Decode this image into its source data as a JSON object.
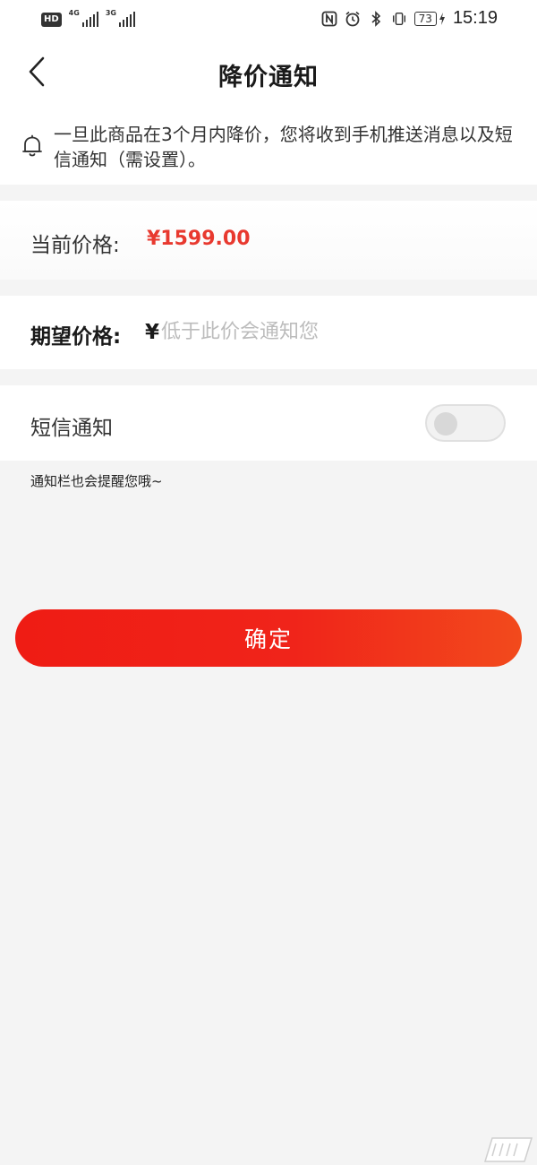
{
  "status_bar": {
    "hd_label": "HD",
    "net1_label": "4G",
    "net2_label": "3G",
    "battery": "73",
    "time": "15:19"
  },
  "nav": {
    "title": "降价通知",
    "back_icon": "chevron-left-icon"
  },
  "notice": {
    "icon": "bell-icon",
    "text": "一旦此商品在3个月内降价，您将收到手机推送消息以及短信通知（需设置）。"
  },
  "current_price": {
    "label": "当前价格:",
    "value": "¥1599.00"
  },
  "expected_price": {
    "label": "期望价格:",
    "currency": "¥",
    "value": "",
    "placeholder": "低于此价会通知您"
  },
  "sms": {
    "label": "短信通知",
    "enabled": false
  },
  "hint": "通知栏也会提醒您哦~",
  "confirm_label": "确定",
  "colors": {
    "accent_red": "#e8392f",
    "button_start": "#ef1c14",
    "button_end": "#f24a1c",
    "background": "#f4f4f4"
  }
}
